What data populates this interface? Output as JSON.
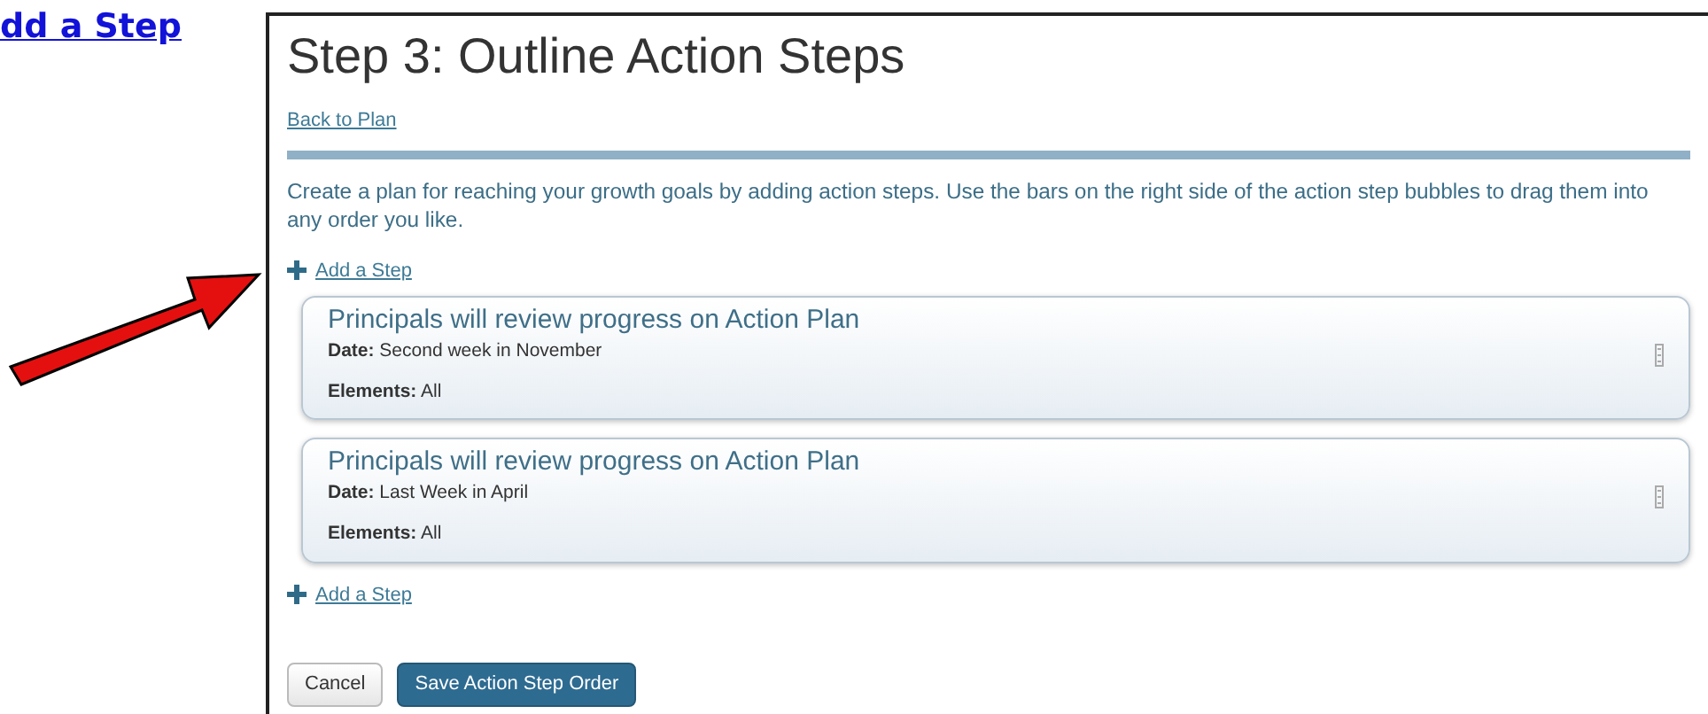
{
  "callout": {
    "text": "dd a Step"
  },
  "page": {
    "title": "Step 3: Outline Action Steps",
    "back_link": "Back to Plan",
    "intro": "Create a plan for reaching your growth goals by adding action steps. Use the bars on the right side of the action step bubbles to drag them into any order you like.",
    "add_top": "Add a Step",
    "steps": [
      {
        "title": "Principals will review progress on Action Plan",
        "date": "**Date:** Second week in November",
        "elements": "**Elements:** All"
      },
      {
        "title": "Principals will review progress on Action Plan",
        "date": "**Date:** Last Week in April",
        "elements": "**Elements:** All"
      }
    ],
    "add_bottom": "Add a Step",
    "buttons": [
      {
        "kind": "secondary",
        "label": "Cancel"
      },
      {
        "kind": "primary",
        "label": "Save Action Step Order"
      }
    ]
  }
}
